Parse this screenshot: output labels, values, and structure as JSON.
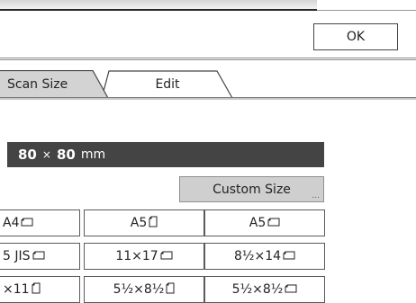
{
  "header": {
    "ok_label": "OK"
  },
  "tabs": [
    {
      "label": "Scan Size",
      "active": true
    },
    {
      "label": "Edit",
      "active": false
    }
  ],
  "size_display": {
    "width": "80",
    "separator": "×",
    "height": "80",
    "unit": "mm"
  },
  "custom_size": {
    "label": "Custom Size",
    "ellipsis": "..."
  },
  "paper_sizes": [
    [
      "A4",
      "A5",
      "A5"
    ],
    [
      "5 JIS",
      "11×17",
      "8½×14"
    ],
    [
      "×11",
      "5½×8½",
      "5½×8½"
    ]
  ],
  "paper_icons": [
    [
      "landscape-icon",
      "portrait-icon",
      "landscape-icon"
    ],
    [
      "landscape-icon",
      "landscape-icon",
      "landscape-icon"
    ],
    [
      "portrait-icon",
      "portrait-icon",
      "landscape-icon"
    ]
  ],
  "colors": {
    "display_bg": "#444444",
    "tab_active_bg": "#d3d3d3",
    "button_selected_bg": "#cfcfcf",
    "border": "#5a5a5a"
  }
}
